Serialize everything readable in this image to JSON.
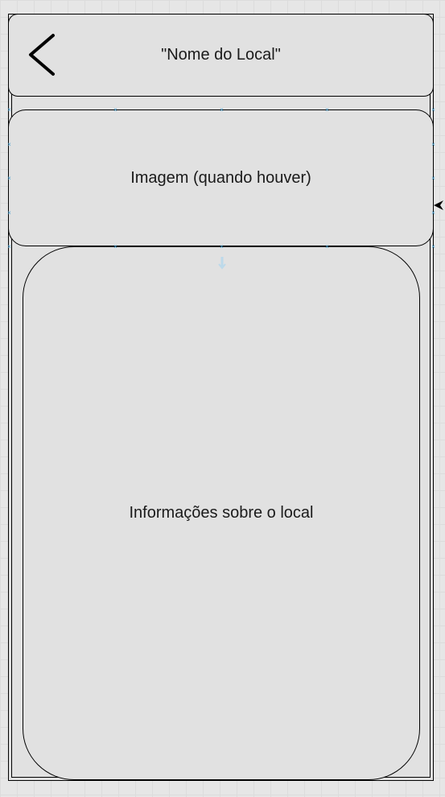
{
  "header": {
    "title": "\"Nome do Local\"",
    "back_icon": "chevron-left-icon"
  },
  "image_area": {
    "label": "Imagem (quando houver)"
  },
  "info_area": {
    "label": "Informações sobre o local"
  },
  "colors": {
    "canvas": "#e6e6e6",
    "shape_fill": "#e1e1e1",
    "stroke": "#000000",
    "selection_handle": "#4aa6d8"
  }
}
